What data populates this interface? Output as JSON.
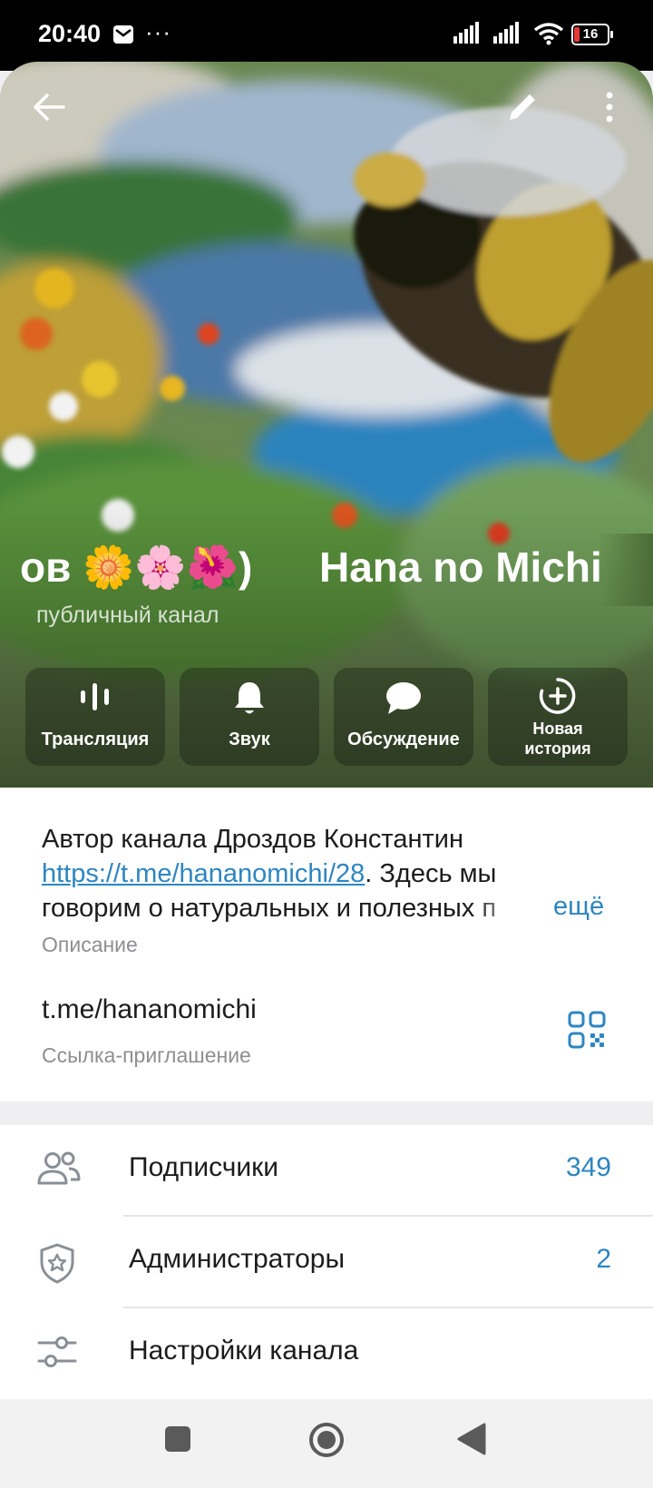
{
  "status": {
    "time": "20:40",
    "more": "···",
    "battery": "16"
  },
  "header": {
    "title_part1": "ов 🌼🌸🌺)",
    "title_part2": "Hana no Michi",
    "subtitle": "публичный канал"
  },
  "actions": [
    {
      "label": "Трансляция",
      "icon": "broadcast-icon"
    },
    {
      "label": "Звук",
      "icon": "bell-icon"
    },
    {
      "label": "Обсуждение",
      "icon": "chat-bubble-icon"
    },
    {
      "label": "Новая",
      "label2": "история",
      "icon": "add-story-icon"
    }
  ],
  "info": {
    "desc_line1": "Автор канала Дроздов Константин",
    "desc_link": "https://t.me/hananomichi/28",
    "desc_after_link": ". Здесь мы",
    "desc_line3": "говорим о натуральных и полезных п",
    "more": "ещё",
    "desc_caption": "Описание",
    "invite_link": "t.me/hananomichi",
    "invite_caption": "Ссылка-приглашение"
  },
  "list": [
    {
      "label": "Подписчики",
      "value": "349",
      "icon": "subscribers-icon"
    },
    {
      "label": "Администраторы",
      "value": "2",
      "icon": "admin-shield-icon"
    },
    {
      "label": "Настройки канала",
      "value": "",
      "icon": "settings-sliders-icon"
    }
  ],
  "colors": {
    "accent": "#2e86c1",
    "status_bar": "#000000",
    "battery_low": "#e53935"
  }
}
